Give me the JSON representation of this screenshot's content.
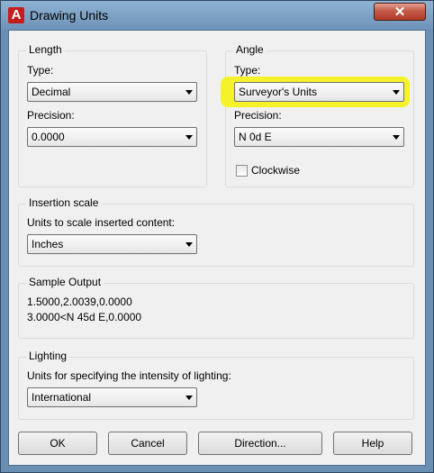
{
  "window": {
    "title": "Drawing Units",
    "close_glyph": "✕"
  },
  "length": {
    "group_label": "Length",
    "type_label": "Type:",
    "type_value": "Decimal",
    "precision_label": "Precision:",
    "precision_value": "0.0000"
  },
  "angle": {
    "group_label": "Angle",
    "type_label": "Type:",
    "type_value": "Surveyor's Units",
    "precision_label": "Precision:",
    "precision_value": "N 0d E",
    "clockwise_label": "Clockwise",
    "clockwise_checked": false,
    "highlight_color": "#f6f22a"
  },
  "insertion": {
    "group_label": "Insertion scale",
    "units_label": "Units to scale inserted content:",
    "units_value": "Inches"
  },
  "sample": {
    "group_label": "Sample Output",
    "line1": "1.5000,2.0039,0.0000",
    "line2": "3.0000<N 45d E,0.0000"
  },
  "lighting": {
    "group_label": "Lighting",
    "units_label": "Units for specifying the intensity of lighting:",
    "units_value": "International"
  },
  "buttons": {
    "ok": "OK",
    "cancel": "Cancel",
    "direction": "Direction...",
    "help": "Help"
  }
}
